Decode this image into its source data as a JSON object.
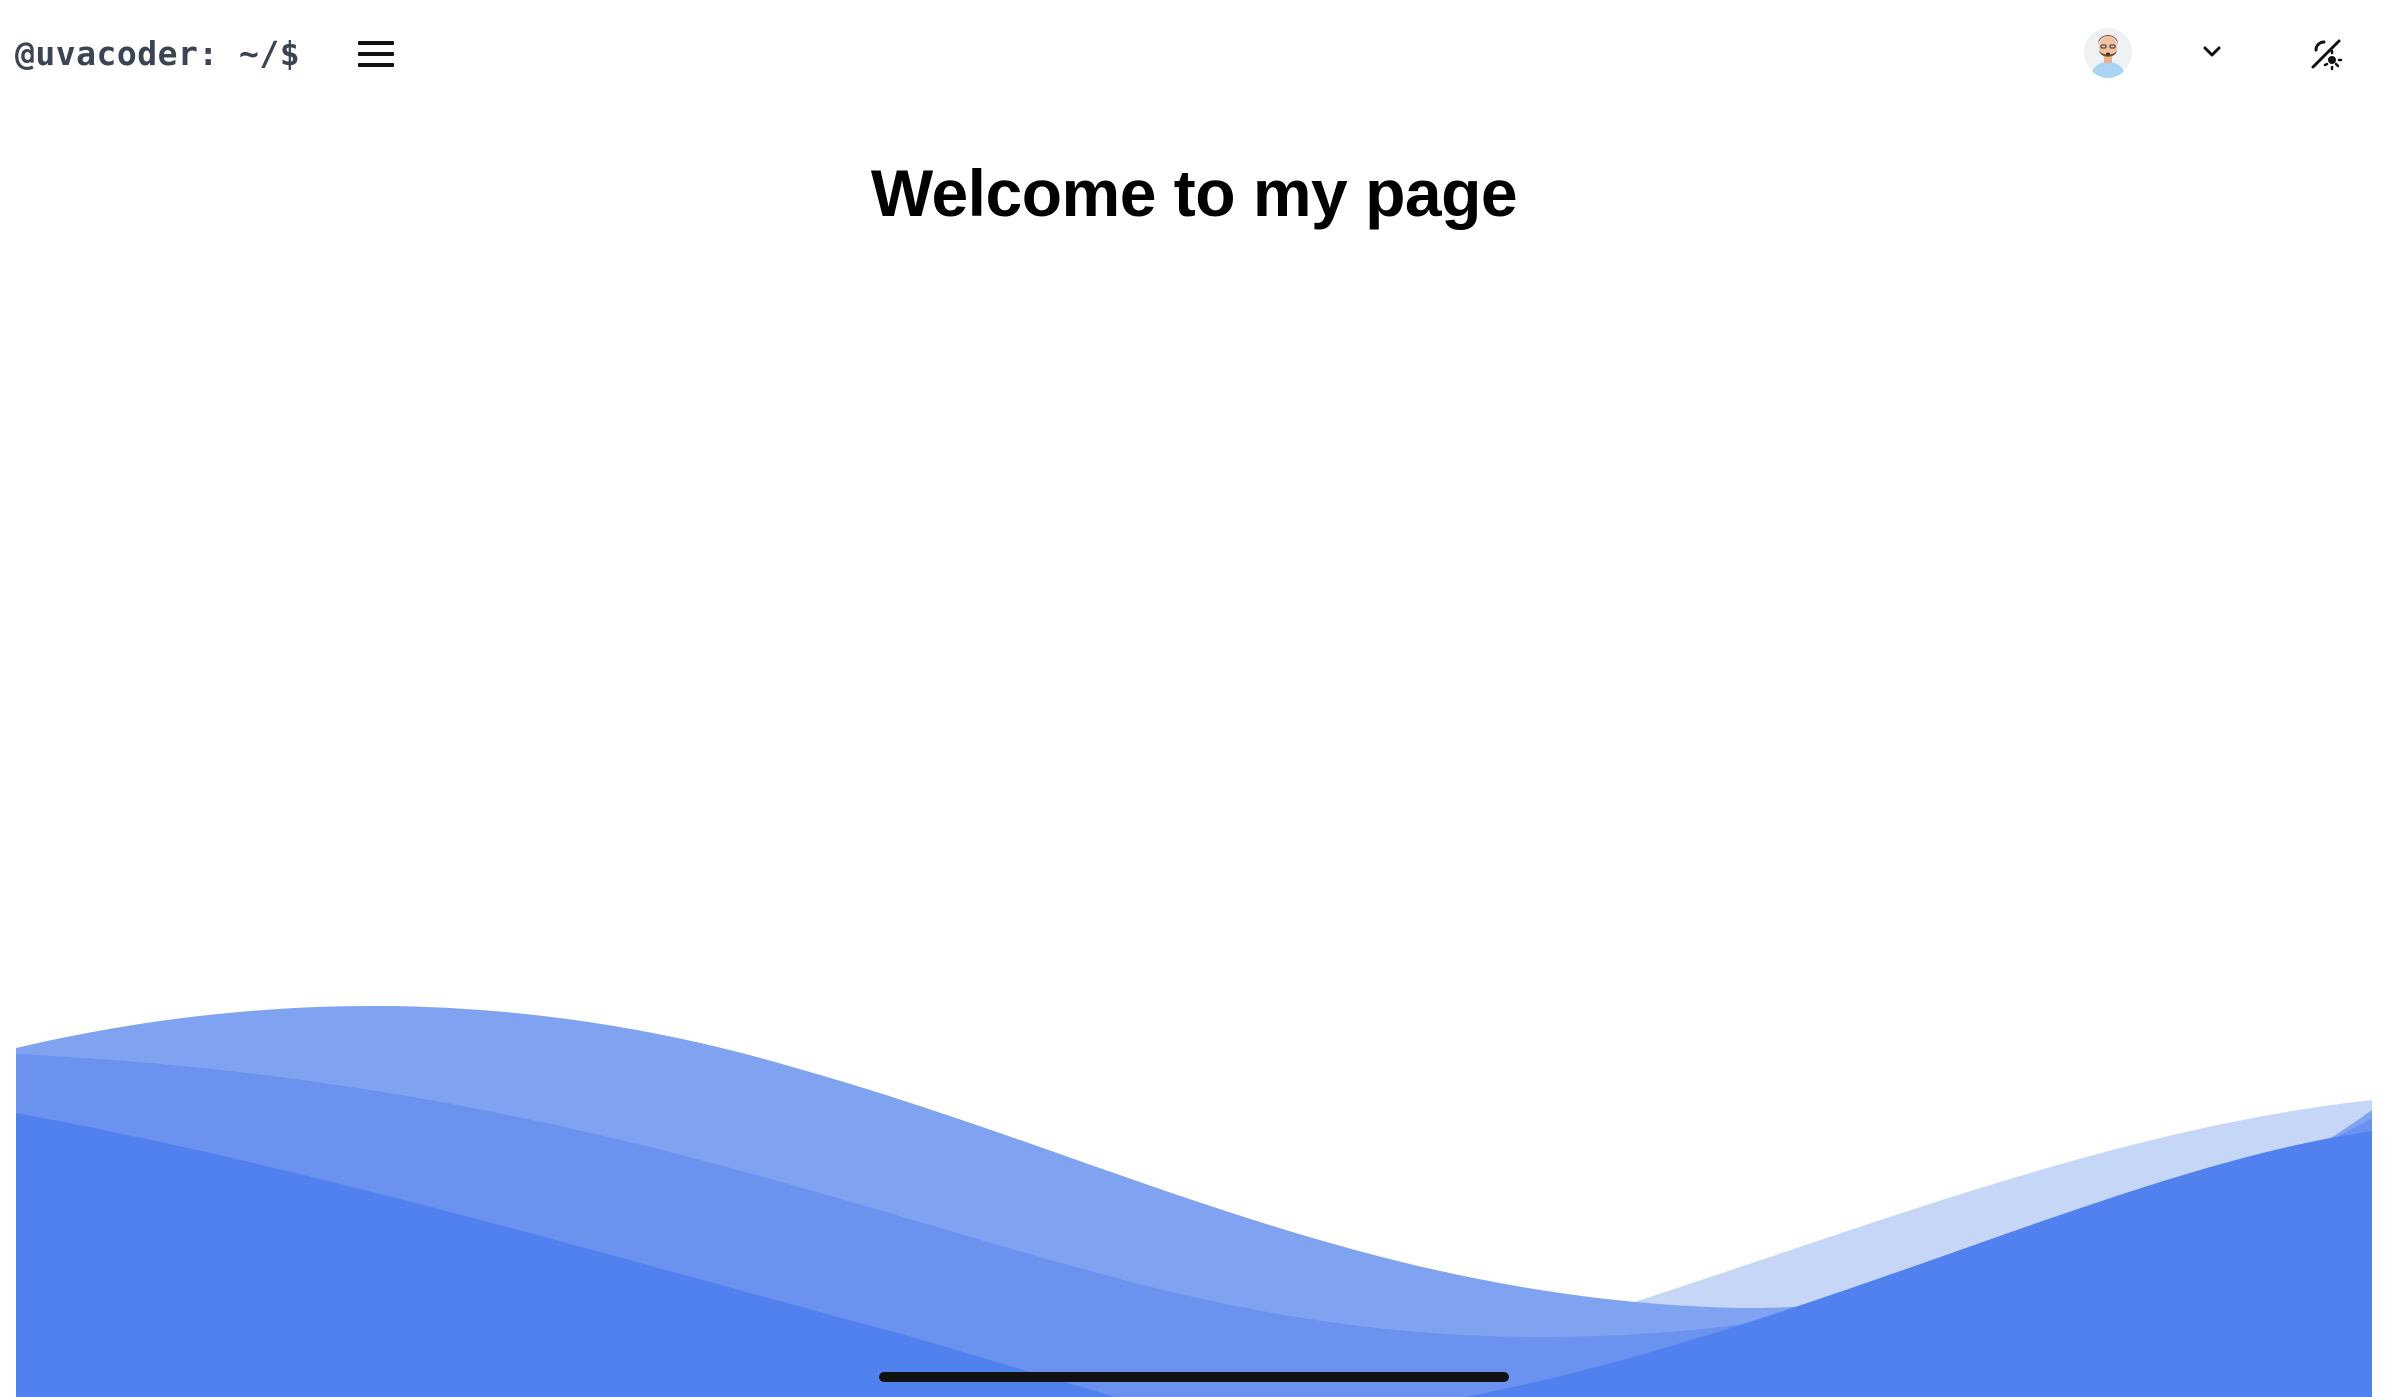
{
  "header": {
    "brand": "@uvacoder: ~/$",
    "menu_icon": "hamburger-menu-icon",
    "avatar_icon": "user-avatar-icon",
    "dropdown_icon": "chevron-down-icon",
    "theme_icon": "theme-toggle-icon"
  },
  "main": {
    "title": "Welcome to my page"
  },
  "colors": {
    "wave_light": "#c5d6f7",
    "wave_mid": "#7fa3f0",
    "wave_mid_dark": "#6a92ee",
    "wave_dark": "#5181ee",
    "accent": "#5181ee",
    "text": "#000000",
    "brand_text": "#3a4452"
  }
}
